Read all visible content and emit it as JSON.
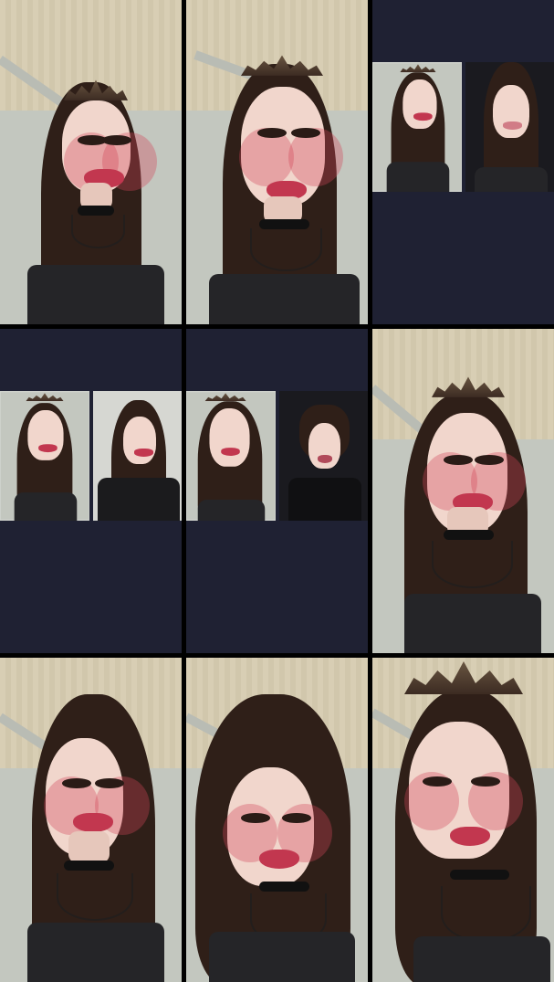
{
  "layout": {
    "tiles": [
      {
        "id": "t1",
        "type": "portrait"
      },
      {
        "id": "t2",
        "type": "portrait"
      },
      {
        "id": "t3",
        "type": "split"
      },
      {
        "id": "t4",
        "type": "split"
      },
      {
        "id": "t5",
        "type": "split"
      },
      {
        "id": "t6",
        "type": "portrait"
      },
      {
        "id": "t7",
        "type": "portrait"
      },
      {
        "id": "t8",
        "type": "portrait"
      },
      {
        "id": "t9",
        "type": "portrait"
      }
    ]
  },
  "colors": {
    "page_bg": "#000000",
    "split_bg": "#1f2133",
    "hair": "#2f1f18",
    "lips": "#c2374f"
  }
}
